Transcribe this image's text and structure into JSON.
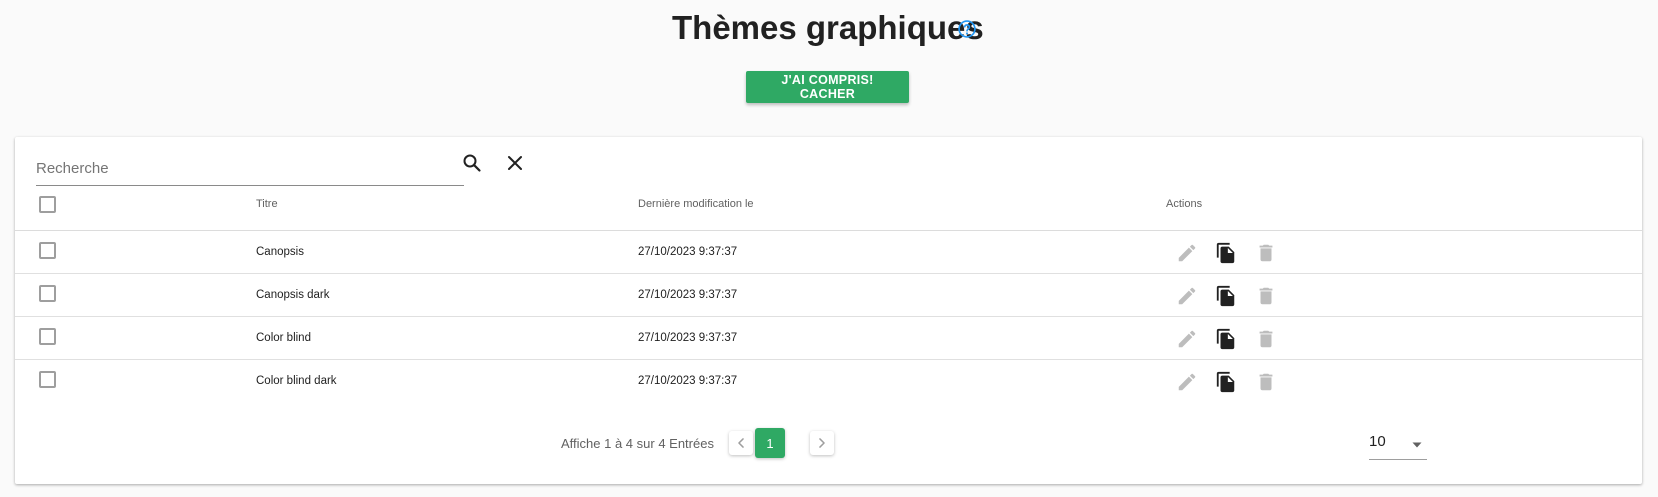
{
  "header": {
    "title": "Thèmes graphiques",
    "hide_button_label": "J'ai compris! Cacher"
  },
  "search": {
    "placeholder": "Recherche",
    "value": ""
  },
  "table": {
    "columns": {
      "title": "Titre",
      "modified": "Dernière modification le",
      "actions": "Actions"
    },
    "rows": [
      {
        "title": "Canopsis",
        "modified": "27/10/2023 9:37:37"
      },
      {
        "title": "Canopsis dark",
        "modified": "27/10/2023 9:37:37"
      },
      {
        "title": "Color blind",
        "modified": "27/10/2023 9:37:37"
      },
      {
        "title": "Color blind dark",
        "modified": "27/10/2023 9:37:37"
      }
    ]
  },
  "pagination": {
    "info": "Affiche 1 à 4 sur 4 Entrées",
    "current_page": "1",
    "per_page": "10"
  },
  "icons": {
    "help": "help-circle-icon",
    "search": "search-icon",
    "clear": "close-icon",
    "edit": "pencil-icon",
    "duplicate": "copy-icon",
    "delete": "trash-icon",
    "prev": "chevron-left-icon",
    "next": "chevron-right-icon",
    "dropdown": "caret-down-icon"
  },
  "colors": {
    "accent": "#2fa964",
    "help_icon": "#2196f3",
    "disabled_icon": "#bdbdbd"
  }
}
